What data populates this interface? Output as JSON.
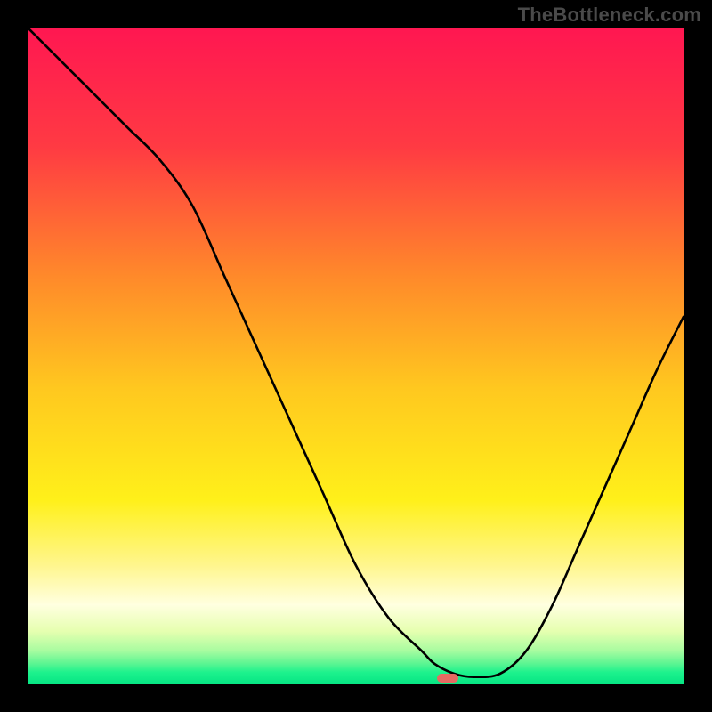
{
  "watermark": "TheBottleneck.com",
  "chart_data": {
    "type": "line",
    "title": "",
    "xlabel": "",
    "ylabel": "",
    "xlim": [
      0,
      100
    ],
    "ylim": [
      0,
      100
    ],
    "x": [
      0,
      5,
      10,
      15,
      20,
      25,
      30,
      35,
      40,
      45,
      50,
      55,
      60,
      62,
      65,
      68,
      72,
      76,
      80,
      84,
      88,
      92,
      96,
      100
    ],
    "values": [
      100,
      95,
      90,
      85,
      80,
      73,
      62,
      51,
      40,
      29,
      18,
      10,
      5,
      3,
      1.5,
      1,
      1.5,
      5,
      12,
      21,
      30,
      39,
      48,
      56
    ],
    "gradient_stops": [
      {
        "offset": 0,
        "color": "#ff1751"
      },
      {
        "offset": 18,
        "color": "#ff3a43"
      },
      {
        "offset": 38,
        "color": "#ff8a2a"
      },
      {
        "offset": 55,
        "color": "#ffc81f"
      },
      {
        "offset": 72,
        "color": "#fff01a"
      },
      {
        "offset": 82,
        "color": "#fff68e"
      },
      {
        "offset": 88,
        "color": "#ffffe0"
      },
      {
        "offset": 92,
        "color": "#e6ffb0"
      },
      {
        "offset": 95,
        "color": "#a8fca0"
      },
      {
        "offset": 97,
        "color": "#5af592"
      },
      {
        "offset": 98.3,
        "color": "#1df28d"
      },
      {
        "offset": 100,
        "color": "#07e684"
      }
    ],
    "marker": {
      "x_center": 64,
      "width_pct": 3.2,
      "color": "#e66a62"
    }
  }
}
